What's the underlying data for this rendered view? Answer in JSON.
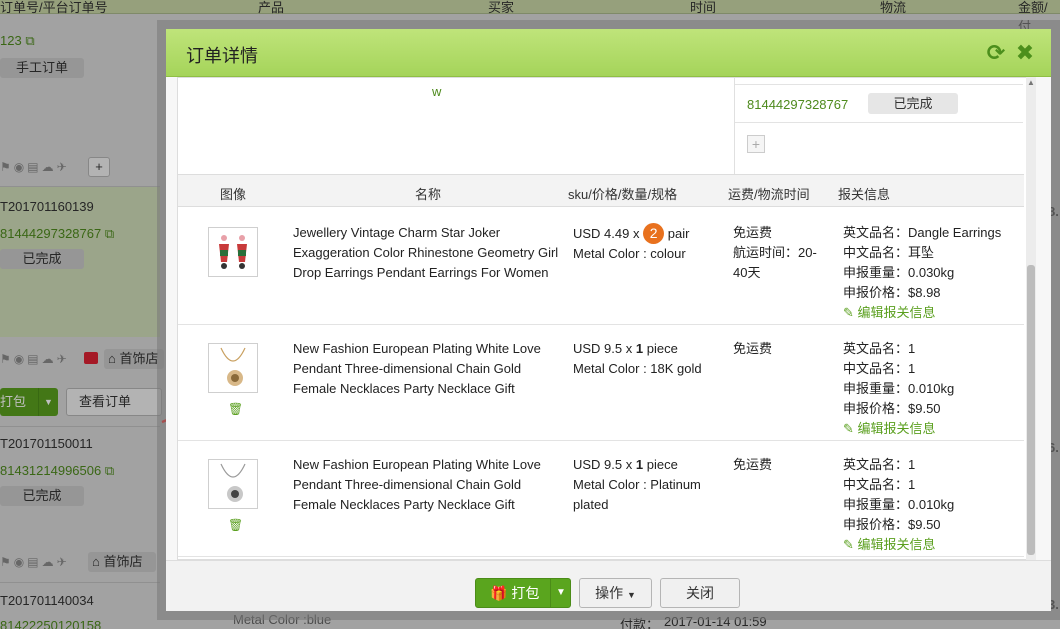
{
  "background": {
    "columns": [
      "订单号/平台订单号",
      "产品",
      "买家",
      "时间",
      "物流",
      "金额/付"
    ],
    "rows": [
      {
        "order_frag": "123",
        "tag": "手工订单"
      },
      {
        "order": "T201701160139",
        "tracking": "81444297328767",
        "status": "已完成",
        "store": "首饰店",
        "pack": "打包",
        "view": "查看订单"
      },
      {
        "order": "T201701150011",
        "tracking": "81431214996506",
        "status": "已完成",
        "store": "首饰店"
      },
      {
        "order": "T201701140034",
        "tracking": "81422250120158"
      }
    ],
    "bottom_product_text": "Metal Color :blue",
    "bottom_paid_label": "付款：",
    "bottom_paid_time": "2017-01-14 01:59",
    "right_amounts": [
      "8.",
      "6.",
      "3."
    ]
  },
  "modal": {
    "title": "订单详情",
    "upper": {
      "stray_text": "w",
      "tracking": "81444297328767",
      "status": "已完成"
    },
    "table_headers": [
      "图像",
      "名称",
      "sku/价格/数量/规格",
      "运费/物流时间",
      "报关信息"
    ],
    "items": [
      {
        "name": "Jewellery Vintage Charm Star Joker Exaggeration Color Rhinestone Geometry Girl Drop Earrings Pendant Earrings For Women",
        "price": "USD 4.49 x",
        "qty": "2",
        "unit": "pair",
        "spec": "Metal Color : colour",
        "shipping": "免运费",
        "ship_time": "航运时间：20-40天",
        "decl_en": "英文品名：Dangle Earrings",
        "decl_cn": "中文品名：耳坠",
        "decl_weight": "申报重量：0.030kg",
        "decl_price": "申报价格：$8.98",
        "edit": "编辑报关信息"
      },
      {
        "name": "New Fashion European Plating White Love Pendant Three-dimensional Chain Gold Female Necklaces Party Necklace Gift",
        "price": "USD 9.5 x",
        "qty": "1",
        "unit": "piece",
        "spec": "Metal Color : 18K gold",
        "shipping": "免运费",
        "ship_time": "",
        "decl_en": "英文品名：1",
        "decl_cn": "中文品名：1",
        "decl_weight": "申报重量：0.010kg",
        "decl_price": "申报价格：$9.50",
        "edit": "编辑报关信息"
      },
      {
        "name": "New Fashion European Plating White Love Pendant Three-dimensional Chain Gold Female Necklaces Party Necklace Gift",
        "price": "USD 9.5 x",
        "qty": "1",
        "unit": "piece",
        "spec": "Metal Color : Platinum plated",
        "shipping": "免运费",
        "ship_time": "",
        "decl_en": "英文品名：1",
        "decl_cn": "中文品名：1",
        "decl_weight": "申报重量：0.010kg",
        "decl_price": "申报价格：$9.50",
        "edit": "编辑报关信息"
      }
    ],
    "footer": {
      "pack_label": "打包",
      "operate_label": "操作",
      "close_label": "关闭"
    }
  },
  "colors": {
    "accent_green": "#5aa51e",
    "header_green": "#a5d45a",
    "qty_badge": "#e8711e"
  }
}
